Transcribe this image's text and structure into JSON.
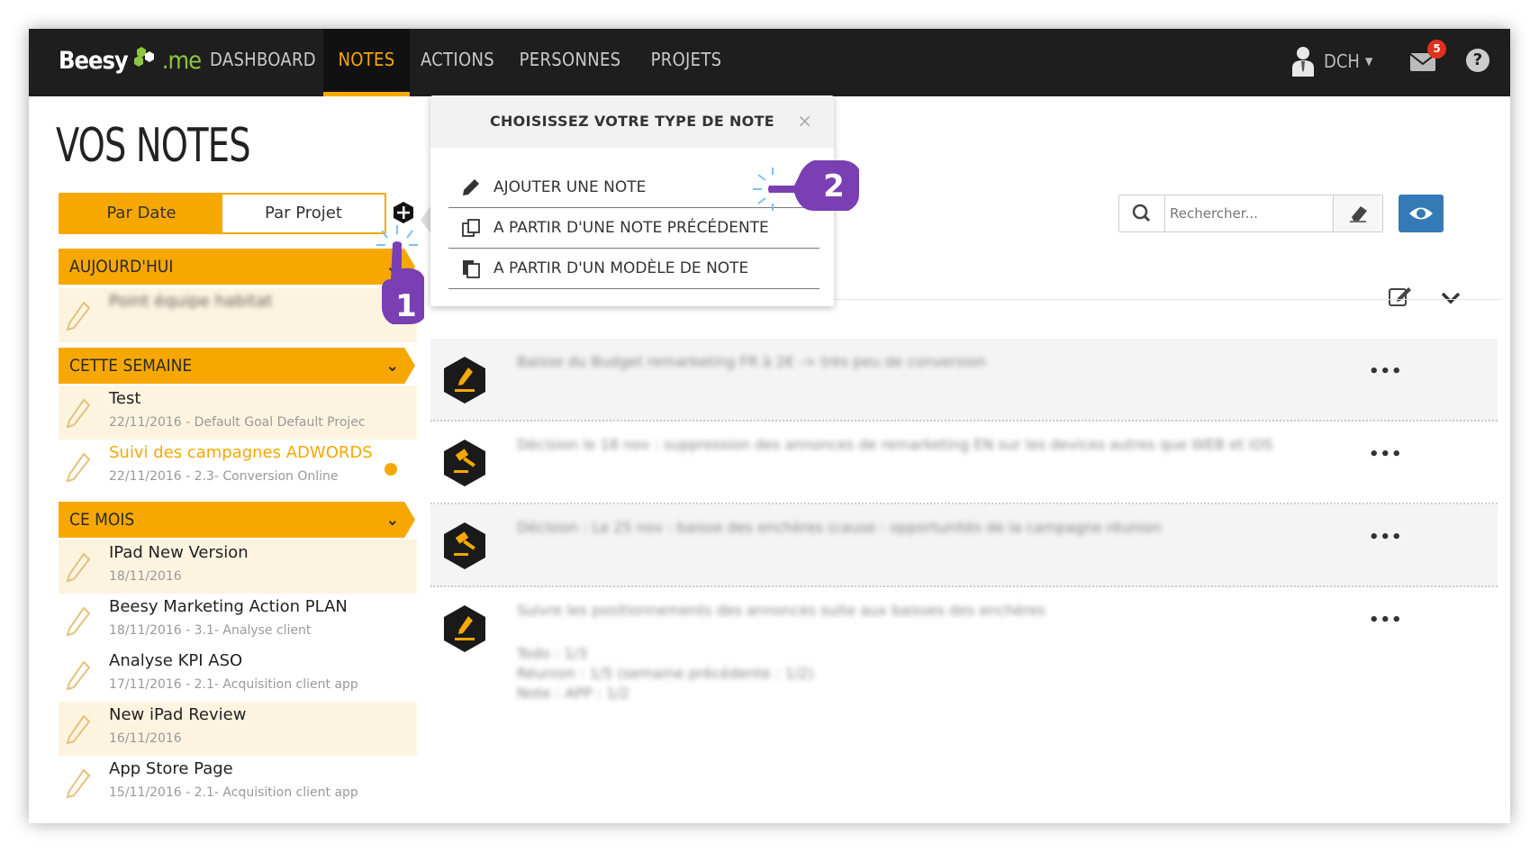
{
  "app": {
    "logo_main": "Beesy",
    "logo_suffix": ".me"
  },
  "nav": {
    "items": [
      "DASHBOARD",
      "NOTES",
      "ACTIONS",
      "PERSONNES",
      "PROJETS"
    ],
    "active": "NOTES",
    "user": "DCH",
    "mail_count": "5",
    "help": "?"
  },
  "left": {
    "title": "VOS NOTES",
    "toggle": {
      "par_date": "Par Date",
      "par_projet": "Par Projet"
    },
    "sections": {
      "today": "AUJOURD'HUI",
      "week": "CETTE SEMAINE",
      "month": "CE MOIS"
    },
    "today_notes": [
      {
        "title": "Point équipe habitat",
        "meta": ""
      }
    ],
    "week_notes": [
      {
        "title": "Test",
        "meta": "22/11/2016  -  Default Goal Default Projec"
      },
      {
        "title": "Suivi des campagnes ADWORDS",
        "meta": "22/11/2016  -  2.3- Conversion Online"
      }
    ],
    "month_notes": [
      {
        "title": "IPad New Version",
        "meta": "18/11/2016"
      },
      {
        "title": "Beesy Marketing Action PLAN",
        "meta": "18/11/2016  -  3.1- Analyse client"
      },
      {
        "title": "Analyse KPI ASO",
        "meta": "17/11/2016  -  2.1- Acquisition client app"
      },
      {
        "title": "New iPad Review",
        "meta": "16/11/2016"
      },
      {
        "title": "App Store Page",
        "meta": "15/11/2016  -  2.1- Acquisition client app"
      }
    ]
  },
  "popup": {
    "title": "CHOISISSEZ VOTRE TYPE DE NOTE",
    "close": "×",
    "items": [
      "AJOUTER UNE NOTE",
      "A PARTIR D'UNE NOTE PRÉCÉDENTE",
      "A PARTIR D'UN MODÈLE DE NOTE"
    ]
  },
  "search": {
    "placeholder": "Rechercher..."
  },
  "rows": [
    {
      "text": "Baisse du Budget remarketing FR à 2€ -> très peu de conversion",
      "menu": "•••"
    },
    {
      "text": "Décision le 18 nov : suppression des annonces de remarketing EN sur les devices autres que WEB et iOS",
      "menu": "•••"
    },
    {
      "text": "Décision : Le 25 nov : baisse des enchères (cause : opportunités de la campagne réunion",
      "menu": "•••"
    },
    {
      "text": "Suivre les positionnements des annonces suite aux baisses des enchères",
      "menu": "•••",
      "extra": [
        "Todo : 1/3",
        "Réunion : 1/5 (semaine précédente : 1/2)",
        "Note : APP : 1/2"
      ]
    }
  ],
  "callouts": {
    "one": "1",
    "two": "2"
  },
  "colors": {
    "accent": "#f7a800",
    "nav_bg": "#1e1e1e",
    "blue": "#337ab7",
    "callout": "#7a3fb2"
  }
}
